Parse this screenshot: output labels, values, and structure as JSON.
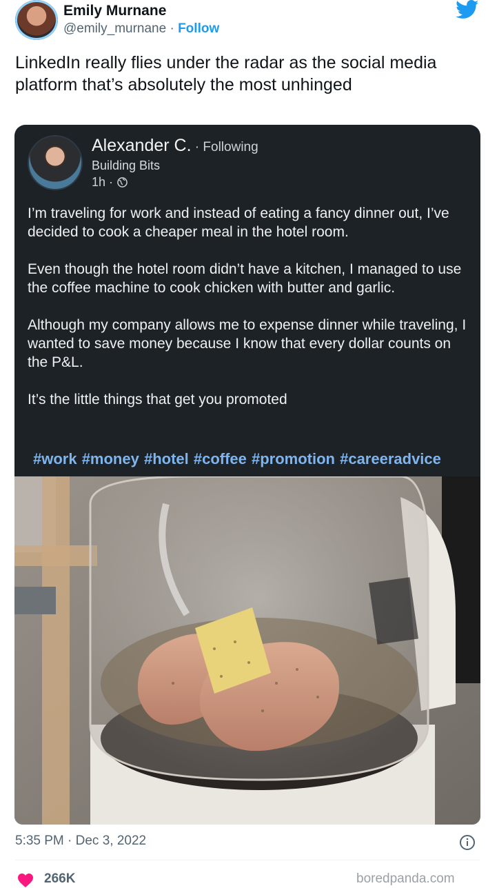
{
  "tweet": {
    "author_name": "Emily Murnane",
    "author_handle": "@emily_murnane",
    "handle_separator": " · ",
    "follow_label": "Follow",
    "text": "LinkedIn really flies under the radar as the social media platform that’s absolutely the most unhinged",
    "timestamp": "5:35 PM · Dec 3, 2022",
    "likes": "266K"
  },
  "linkedin_post": {
    "author_name": "Alexander C.",
    "follow_status": " · Following",
    "headline": "Building Bits",
    "time": "1h ·",
    "paragraphs": [
      "I’m traveling for work and instead of eating a fancy dinner out, I’ve decided to cook a cheaper meal in the hotel room.",
      "Even though the hotel room didn’t have a kitchen, I managed to use the coffee machine to cook chicken with butter and garlic.",
      "Although my company allows me to expense dinner while traveling, I wanted to save money because I know that every dollar counts on the P&L.",
      "It’s the little things that get you promoted"
    ],
    "hashtags": "#work #money #hotel #coffee #promotion #careeradvice"
  },
  "watermark": "boredpanda.com",
  "icons": {
    "brand": "twitter-bird-icon",
    "visibility": "globe-icon",
    "info": "info-icon",
    "like": "heart-icon"
  },
  "colors": {
    "twitter_blue": "#1d9bf0",
    "linkedin_card_bg": "#1d2226",
    "hashtag": "#7fb5ee",
    "like_red": "#f91880"
  }
}
